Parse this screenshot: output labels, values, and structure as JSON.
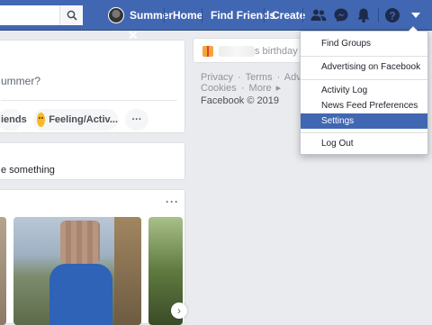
{
  "search": {
    "placeholder": ""
  },
  "nav": {
    "user_name": "Summer",
    "home": "Home",
    "find_friends": "Find Friends",
    "create": "Create",
    "icons": [
      "friend-requests-icon",
      "messenger-icon",
      "notifications-icon",
      "help-icon",
      "account-menu-arrow-icon"
    ]
  },
  "composer": {
    "prompt": "ummer?",
    "friends_pill": "iends",
    "feeling_pill": "Feeling/Activ...",
    "more": "···"
  },
  "share": {
    "text": "e something"
  },
  "stories": {
    "more": "···",
    "close": "✕",
    "next": "›"
  },
  "birthday": {
    "text": "s birthday is t"
  },
  "footer": {
    "links": [
      "Privacy",
      "·",
      "Terms",
      "·",
      "Advertisin",
      "Cookies",
      "·",
      "More",
      "▸"
    ],
    "copyright": "Facebook © 2019"
  },
  "menu": {
    "items": [
      {
        "label": "Find Groups",
        "active": false
      },
      {
        "label": "Advertising on Facebook",
        "active": false
      },
      {
        "label": "Activity Log",
        "active": false
      },
      {
        "label": "News Feed Preferences",
        "active": false
      },
      {
        "label": "Settings",
        "active": true
      },
      {
        "label": "Log Out",
        "active": false
      }
    ]
  },
  "colors": {
    "brand_blue": "#4267b2",
    "page_bg": "#e9ebee",
    "menu_highlight": "#4267b2"
  }
}
